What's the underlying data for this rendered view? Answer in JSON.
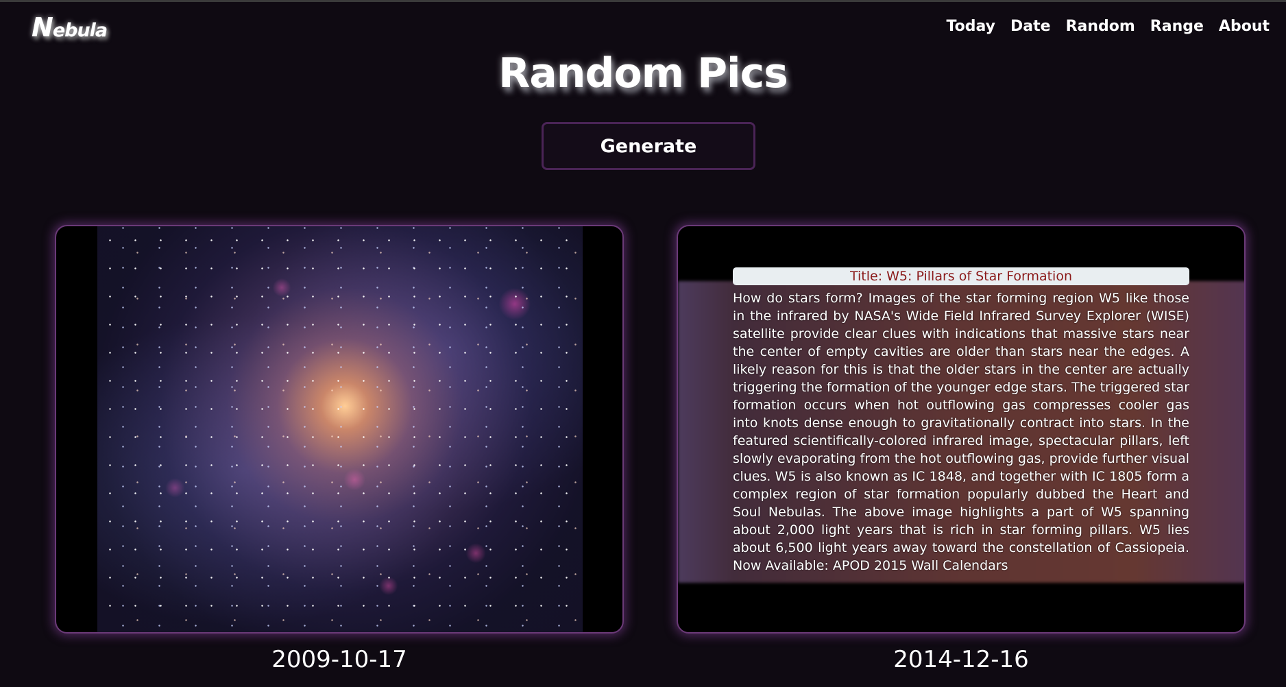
{
  "brand": {
    "logo_big": "N",
    "logo_rest": "ebula"
  },
  "nav": {
    "items": [
      "Today",
      "Date",
      "Random",
      "Range",
      "About"
    ]
  },
  "page": {
    "title": "Random Pics"
  },
  "generate_button": {
    "label": "Generate"
  },
  "cards": [
    {
      "date": "2009-10-17"
    },
    {
      "title": "Title: W5: Pillars of Star Formation",
      "description": "How do stars form? Images of the star forming region W5 like those in the infrared by NASA's Wide Field Infrared Survey Explorer (WISE) satellite provide clear clues with indications that massive stars near the center of empty cavities are older than stars near the edges. A likely reason for this is that the older stars in the center are actually triggering the formation of the younger edge stars. The triggered star formation occurs when hot outflowing gas compresses cooler gas into knots dense enough to gravitationally contract into stars. In the featured scientifically-colored infrared image, spectacular pillars, left slowly evaporating from the hot outflowing gas, provide further visual clues. W5 is also known as IC 1848, and together with IC 1805 form a complex region of star formation popularly dubbed the Heart and Soul Nebulas. The above image highlights a part of W5 spanning about 2,000 light years that is rich in star forming pillars. W5 lies about 6,500 light years away toward the constellation of Cassiopeia. Now Available: APOD 2015 Wall Calendars",
      "date": "2014-12-16"
    }
  ],
  "colors": {
    "background": "#0f0a12",
    "card_border": "#6b3a78",
    "button_border": "#4a2456",
    "title_pill_bg": "#e9eef1",
    "title_pill_text": "#8b1a1a"
  }
}
